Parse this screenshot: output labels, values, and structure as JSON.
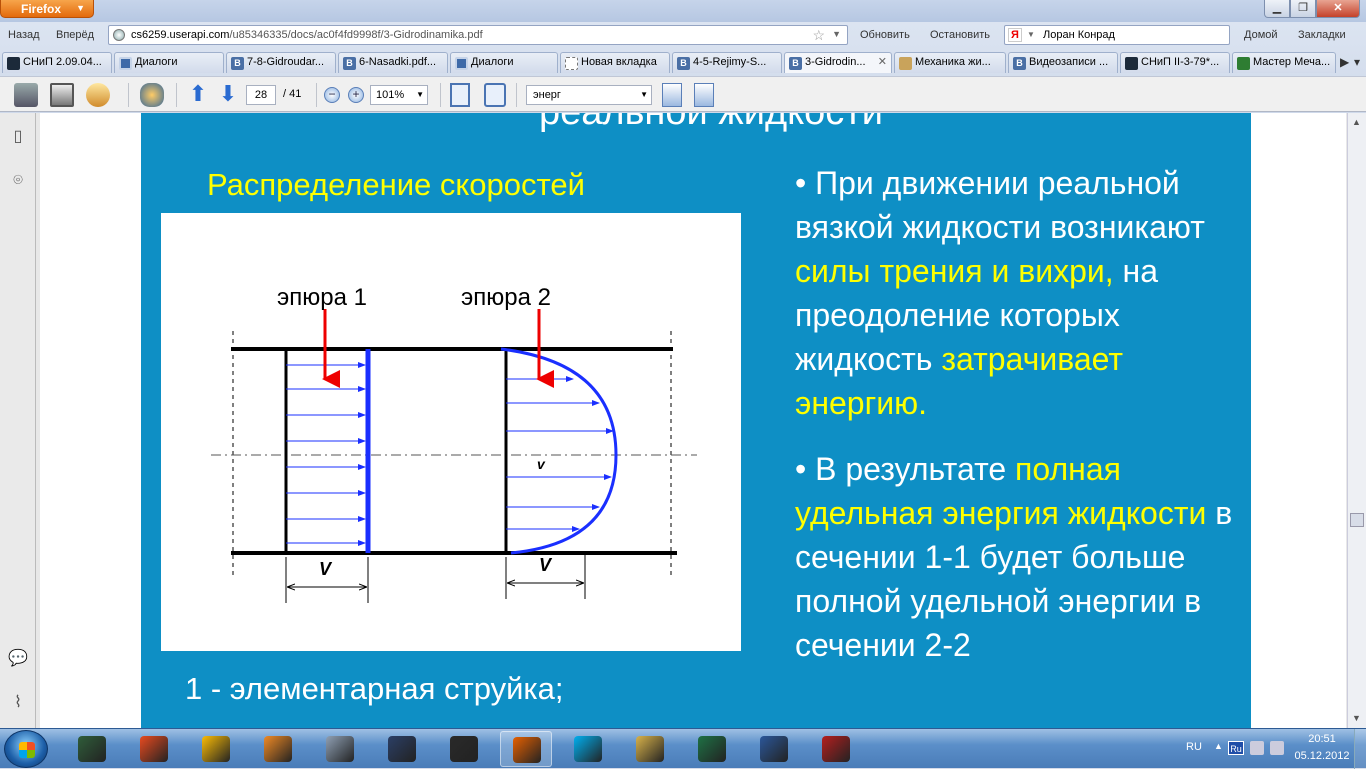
{
  "browser": {
    "app_button": "Firefox",
    "nav": {
      "back": "Назад",
      "forward": "Вперёд",
      "refresh": "Обновить",
      "stop": "Остановить",
      "home": "Домой",
      "bookmarks": "Закладки"
    },
    "url": {
      "host": "cs6259.userapi.com",
      "path": "/u85346335/docs/ac0f4fd9998f/3-Gidrodinamika.pdf"
    },
    "search_user": "Лоран Конрад",
    "tabs": [
      {
        "label": "СНиП 2.09.04...",
        "icon": "snip-icon",
        "color": "#1c2a3a"
      },
      {
        "label": "Диалоги",
        "icon": "chat-icon",
        "color": "#3e6aa8"
      },
      {
        "label": "7-8-Gidroudar...",
        "icon": "vk-icon",
        "color": "#4a6fa5"
      },
      {
        "label": "6-Nasadki.pdf...",
        "icon": "vk-icon",
        "color": "#4a6fa5"
      },
      {
        "label": "Диалоги",
        "icon": "chat-icon",
        "color": "#3e6aa8"
      },
      {
        "label": "Новая вкладка",
        "icon": "blank-tab-icon",
        "color": "#ffffff"
      },
      {
        "label": "4-5-Rejimy-S...",
        "icon": "vk-icon",
        "color": "#4a6fa5"
      },
      {
        "label": "3-Gidrodin...",
        "icon": "vk-icon",
        "color": "#4a6fa5",
        "active": true
      },
      {
        "label": "Механика жи...",
        "icon": "folder-icon",
        "color": "#c9a35b"
      },
      {
        "label": "Видеозаписи ...",
        "icon": "vk-icon",
        "color": "#4a6fa5"
      },
      {
        "label": "СНиП II-3-79*...",
        "icon": "snip-icon",
        "color": "#1c2a3a"
      },
      {
        "label": "Мастер Меча...",
        "icon": "snip-icon",
        "color": "#2e7d32"
      }
    ]
  },
  "pdf_toolbar": {
    "page_current": "28",
    "page_total": "/ 41",
    "zoom": "101%",
    "find_text": "энерг"
  },
  "slide": {
    "title_partial": "реальной жидкости",
    "subtitle": "Распределение скоростей",
    "diagram": {
      "label_1": "эпюра 1",
      "label_2": "эпюра 2",
      "v_inside": "v",
      "v_dim_1": "V",
      "v_dim_2": "V"
    },
    "caption": "1 - элементарная струйка;",
    "bullet1": {
      "a": "• При движении реальной вязкой жидкости возникают ",
      "b": "силы трения и вихри,",
      "c": " на преодоление которых жидкость ",
      "d": "затрачивает энергию."
    },
    "bullet2": {
      "a": "• В результате ",
      "b": "полная удельная энергия жидкости",
      "c": " в сечении 1-1 будет больше полной удельной энергии в",
      "d": " сечении 2-2"
    }
  },
  "taskbar": {
    "apps": [
      "explorer-icon",
      "ccleaner-icon",
      "chrome-icon",
      "media-icon",
      "calculator-icon",
      "kmplayer-icon",
      "321-player-icon",
      "firefox-icon",
      "skype-icon",
      "folder-icon",
      "excel-icon",
      "word-icon",
      "autocad-icon"
    ],
    "lang": "RU",
    "kbd": "Ru",
    "time": "20:51",
    "date": "05.12.2012"
  }
}
